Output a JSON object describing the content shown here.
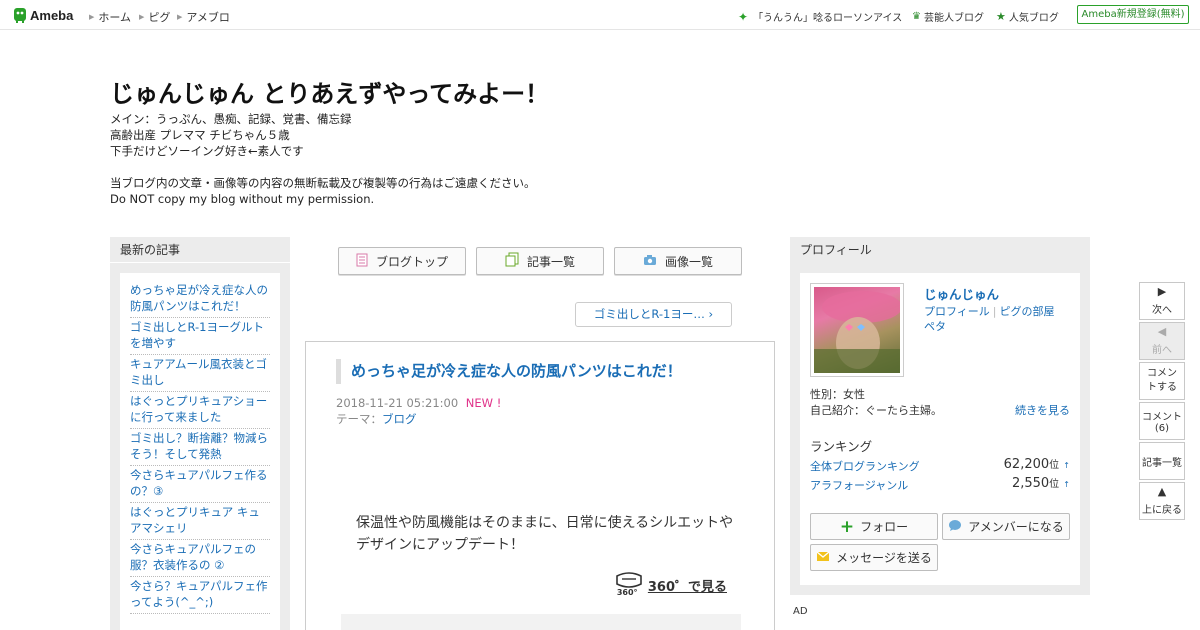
{
  "header": {
    "logo_text": "Ameba",
    "nav": [
      "ホーム",
      "ピグ",
      "アメブロ"
    ],
    "promo": "「うんうん」唸るローソンアイス",
    "celeb_blog": "芸能人ブログ",
    "popular_blog": "人気ブログ",
    "signup": "Ameba新規登録(無料)"
  },
  "blog": {
    "title": "じゅんじゅん とりあえずやってみよー！",
    "desc": [
      "メイン：うっぷん、愚痴、記録、覚書、備忘録",
      "高齢出産 プレママ チビちゃん５歳",
      "下手だけどソーイング好き←素人です",
      "",
      "当ブログ内の文章・画像等の内容の無断転載及び複製等の行為はご遠慮ください。",
      "Do NOT copy my blog without my permission."
    ]
  },
  "left": {
    "heading": "最新の記事",
    "items": [
      "めっちゃ足が冷え症な人の防風パンツはこれだ！",
      "ゴミ出しとR-1ヨーグルトを増やす",
      "キュアアムール風衣装とゴミ出し",
      "はぐっとプリキュアショーに行って来ました",
      "ゴミ出し？断捨離？物減らそう！そして発熱",
      "今さらキュアパルフェ作るの？③",
      "はぐっとプリキュア キュアマシェリ",
      "今さらキュアパルフェの服？衣装作るの ②",
      "今さら？キュアパルフェ作ってよう(^_^;)"
    ]
  },
  "center": {
    "btn_top": "ブログトップ",
    "btn_list": "記事一覧",
    "btn_images": "画像一覧",
    "next_link": "ゴミ出しとR-1ヨー…",
    "article": {
      "title": "めっちゃ足が冷え症な人の防風パンツはこれだ！",
      "datetime": "2018-11-21 05:21:00",
      "new_badge": "NEW !",
      "theme_label": "テーマ：",
      "theme": "ブログ",
      "image_caption": "保温性や防風機能はそのままに、日常に使えるシルエットやデザインにアップデート！",
      "view_360": "360゜で見る",
      "view_360_badge": "360°"
    }
  },
  "profile": {
    "heading": "プロフィール",
    "name": "じゅんじゅん",
    "link_profile": "プロフィール",
    "link_pig": "ピグの部屋",
    "link_peta": "ペタ",
    "gender": "性別：女性",
    "intro": "自己紹介：ぐーたら主婦。",
    "more": "続きを見る",
    "ranking_heading": "ランキング",
    "rank_all_label": "全体ブログランキング",
    "rank_all_value": "62,200",
    "rank_genre_label": "アラフォージャンル",
    "rank_genre_value": "2,550",
    "rank_unit": "位",
    "rank_arrow": "↑",
    "btn_follow": "フォロー",
    "btn_member": "アメンバーになる",
    "btn_message": "メッセージを送る",
    "ad": "AD"
  },
  "sidenav": {
    "next": "次へ",
    "prev": "前へ",
    "comment": "コメントする",
    "comments": "コメント",
    "comments_count": "(6)",
    "list": "記事一覧",
    "top": "上に戻る"
  },
  "colors": {
    "link": "#1a6db5",
    "ameba_green": "#2aa12a",
    "new_pink": "#e0338a",
    "sidebar_bg": "#ececec"
  }
}
